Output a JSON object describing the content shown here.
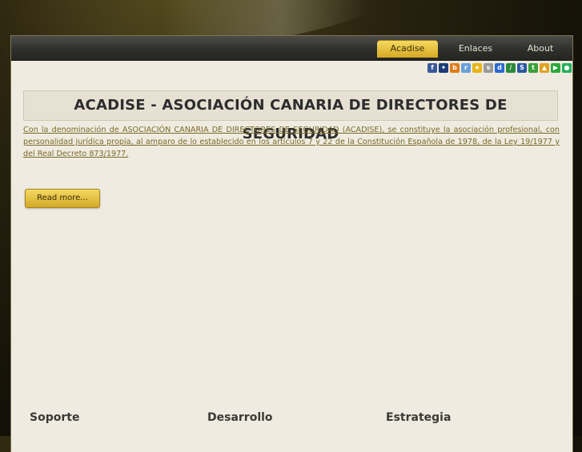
{
  "nav": {
    "items": [
      {
        "label": "Acadise",
        "active": true
      },
      {
        "label": "Enlaces",
        "active": false
      },
      {
        "label": "About",
        "active": false
      }
    ]
  },
  "share_icons": [
    {
      "name": "facebook-icon",
      "color": "#3b5998",
      "glyph": "f"
    },
    {
      "name": "myspace-icon",
      "color": "#1a3a7a",
      "glyph": "✦"
    },
    {
      "name": "blinklist-icon",
      "color": "#e07a1a",
      "glyph": "b"
    },
    {
      "name": "reddit-icon",
      "color": "#6aa0d8",
      "glyph": "r"
    },
    {
      "name": "favorite-star-icon",
      "color": "#e8b416",
      "glyph": "★"
    },
    {
      "name": "simpy-icon",
      "color": "#9a9a9a",
      "glyph": "s"
    },
    {
      "name": "delicious-icon",
      "color": "#2a6ad6",
      "glyph": "d"
    },
    {
      "name": "furl-icon",
      "color": "#2a8a3a",
      "glyph": "/"
    },
    {
      "name": "stumbleupon-icon",
      "color": "#2a5aa0",
      "glyph": "S"
    },
    {
      "name": "technorati-icon",
      "color": "#3aa03a",
      "glyph": "t"
    },
    {
      "name": "digg-icon",
      "color": "#e0a020",
      "glyph": "▲"
    },
    {
      "name": "google-icon",
      "color": "#2aa83a",
      "glyph": "▶"
    },
    {
      "name": "live-icon",
      "color": "#22b05a",
      "glyph": "●"
    }
  ],
  "article": {
    "title": "ACADISE - ASOCIACIÓN CANARIA DE DIRECTORES DE SEGURIDAD",
    "intro": "Con la denominación de ASOCIACIÓN CANARIA DE DIRECTORES DE SEGURIDAD (ACADISE), se constituye la asociación profesional, con personalidad jurídica propia, al amparo de lo establecido en los artículos 7 y 22 de la Constitución Española de 1978, de la Ley 19/1977 y del Real Decreto 873/1977.",
    "read_more": "Read more..."
  },
  "footer": {
    "columns": [
      "Soporte",
      "Desarrollo",
      "Estrategia"
    ]
  }
}
